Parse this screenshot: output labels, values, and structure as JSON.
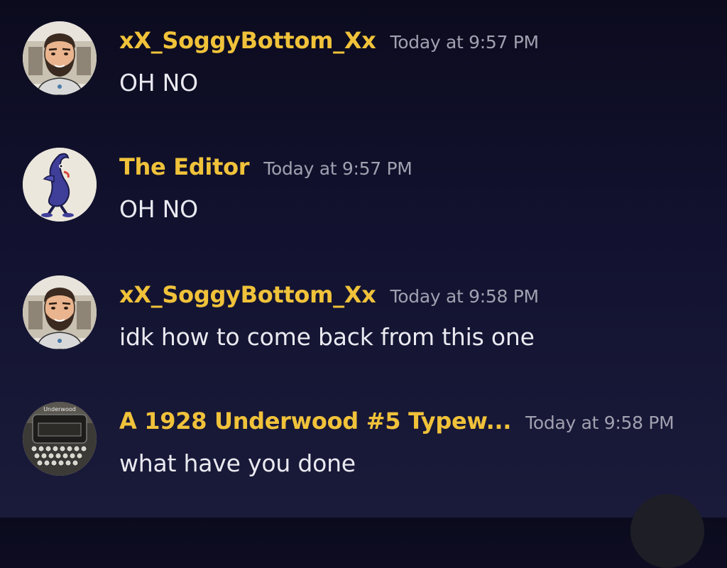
{
  "messages": [
    {
      "username": "xX_SoggyBottom_Xx",
      "timestamp": "Today at 9:57 PM",
      "content": "OH NO",
      "avatar_icon": "bearded-man-avatar"
    },
    {
      "username": "The Editor",
      "timestamp": "Today at 9:57 PM",
      "content": "OH NO",
      "avatar_icon": "blue-creature-avatar"
    },
    {
      "username": "xX_SoggyBottom_Xx",
      "timestamp": "Today at 9:58 PM",
      "content": "idk how to come back from this one",
      "avatar_icon": "bearded-man-avatar"
    },
    {
      "username": "A 1928 Underwood #5 Typew...",
      "timestamp": "Today at 9:58 PM",
      "content": "what have you done",
      "avatar_icon": "typewriter-avatar",
      "avatar_text": "Underwood"
    }
  ],
  "colors": {
    "username": "#f0c23a",
    "timestamp": "#a0a0b0",
    "content": "#e9e9f0",
    "background_top": "#0c0b1e",
    "background_bottom": "#1a1a3a"
  },
  "floating_button_icon": "jump-to-present-button"
}
